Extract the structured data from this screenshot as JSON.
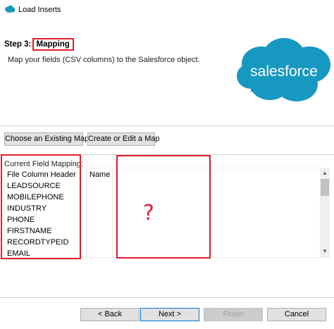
{
  "window": {
    "title": "Load Inserts",
    "icon": "salesforce-cloud-icon"
  },
  "header": {
    "step_prefix": "Step 3:",
    "step_name": "Mapping",
    "subtitle": "Map your fields (CSV columns) to the Salesforce object.",
    "logo_text": "salesforce",
    "logo_color": "#1798c1"
  },
  "toolbar": {
    "choose_label": "Choose an Existing Map",
    "create_label": "Create or Edit a Map"
  },
  "mapping": {
    "caption": "Current Field Mapping:",
    "columns": [
      "File Column Header",
      "Name"
    ],
    "rows": [
      "LEADSOURCE",
      "MOBILEPHONE",
      "INDUSTRY",
      "PHONE",
      "FIRSTNAME",
      "RECORDTYPEID",
      "EMAIL"
    ]
  },
  "annotation": {
    "mark": "?",
    "color": "#e01e2e"
  },
  "footer": {
    "back_label": "< Back",
    "next_label": "Next >",
    "finish_label": "Finish",
    "cancel_label": "Cancel"
  }
}
